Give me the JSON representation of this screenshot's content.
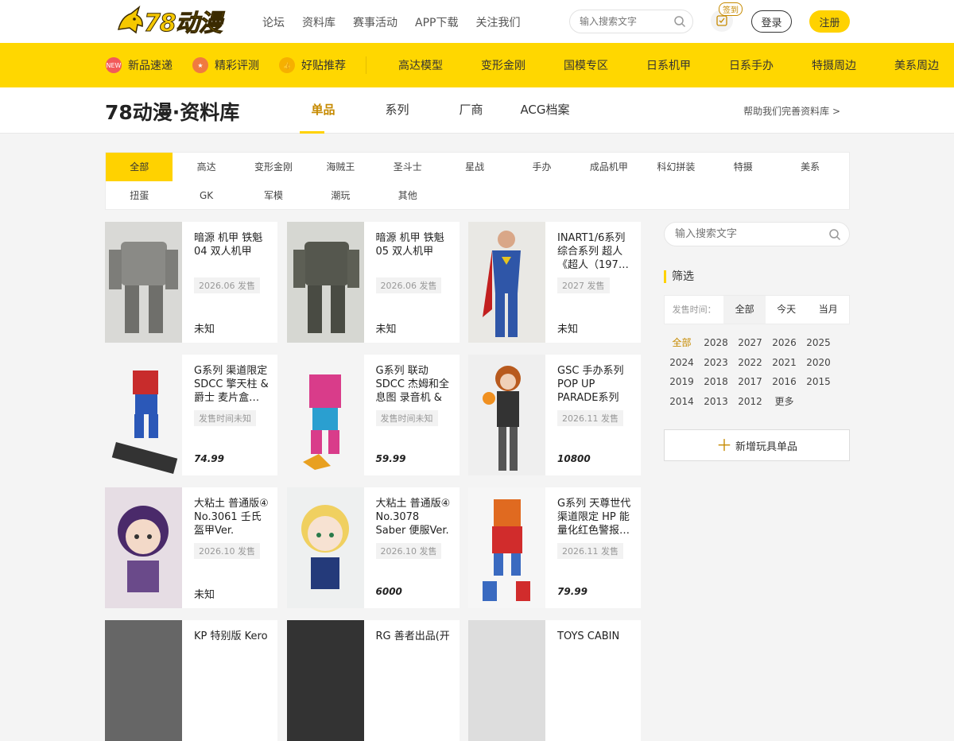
{
  "header": {
    "logo_text": "78动漫",
    "nav": [
      "论坛",
      "资料库",
      "赛事活动",
      "APP下载",
      "关注我们"
    ],
    "search_placeholder": "输入搜索文字",
    "checkin_label": "签到",
    "login_label": "登录",
    "register_label": "注册"
  },
  "category_bar": {
    "featured": [
      {
        "label": "新品速递",
        "icon": "new-badge-icon",
        "color": "#f25a5a"
      },
      {
        "label": "精彩评测",
        "icon": "star-badge-icon",
        "color": "#f07a40"
      },
      {
        "label": "好贴推荐",
        "icon": "thumb-badge-icon",
        "color": "#f6b000"
      }
    ],
    "plain": [
      "高达模型",
      "变形金刚",
      "国模专区",
      "日系机甲",
      "日系手办",
      "特摄周边",
      "美系周边"
    ]
  },
  "subheader": {
    "title": "78动漫·资料库",
    "tabs": [
      "单品",
      "系列",
      "厂商",
      "ACG档案"
    ],
    "help_link": "帮助我们完善资料库 >"
  },
  "categories": {
    "row1": [
      "全部",
      "高达",
      "变形金刚",
      "海贼王",
      "圣斗士",
      "星战",
      "手办",
      "成品机甲",
      "科幻拼装",
      "特摄",
      "美系"
    ],
    "row2": [
      "扭蛋",
      "GK",
      "军模",
      "潮玩",
      "其他"
    ]
  },
  "items": [
    {
      "name": "暗源 机甲 铁魁04 双人机甲",
      "date": "2026.06 发售",
      "price": "未知"
    },
    {
      "name": "暗源 机甲 铁魁05 双人机甲",
      "date": "2026.06 发售",
      "price": "未知"
    },
    {
      "name": "INART1/6系列 综合系列 超人《超人（197…",
      "date": "2027 发售",
      "price": "未知"
    },
    {
      "name": "G系列 渠道限定 SDCC 擎天柱 & 爵士 麦片盒…",
      "date": "发售时间未知",
      "price": "74.99"
    },
    {
      "name": "G系列 联动 SDCC 杰姆和全息图 录音机 & …",
      "date": "发售时间未知",
      "price": "59.99"
    },
    {
      "name": "GSC 手办系列 POP UP PARADE系列 SP …",
      "date": "2026.11 发售",
      "price": "10800"
    },
    {
      "name": "大粘土 普通版④ No.3061 壬氏 盔甲Ver.",
      "date": "2026.10 发售",
      "price": "未知"
    },
    {
      "name": "大粘土 普通版④ No.3078 Saber 便服Ver.",
      "date": "2026.10 发售",
      "price": "6000"
    },
    {
      "name": "G系列 天尊世代 渠道限定 HP 能量化红色警报…",
      "date": "2026.11 发售",
      "price": "79.99"
    },
    {
      "name": "KP 特别版 Kero",
      "date": "",
      "price": ""
    },
    {
      "name": "RG 善者出品(开",
      "date": "",
      "price": ""
    },
    {
      "name": "TOYS CABIN",
      "date": "",
      "price": ""
    }
  ],
  "sidebar": {
    "search_placeholder": "输入搜索文字",
    "filter_title": "筛选",
    "time_label": "发售时间：",
    "time_options": [
      "全部",
      "今天",
      "当月"
    ],
    "years": [
      "全部",
      "2028",
      "2027",
      "2026",
      "2025",
      "2024",
      "2023",
      "2022",
      "2021",
      "2020",
      "2019",
      "2018",
      "2017",
      "2016",
      "2015",
      "2014",
      "2013",
      "2012",
      "更多"
    ],
    "add_label": "新增玩具单品"
  },
  "colors": {
    "brand_yellow": "#ffd700",
    "accent_gold": "#c68a00"
  }
}
